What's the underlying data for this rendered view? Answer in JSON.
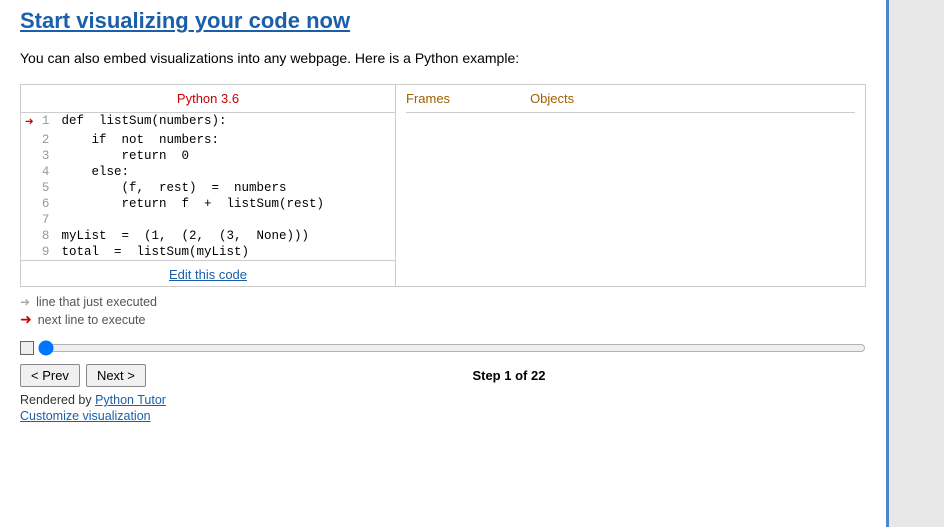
{
  "header": {
    "title": "Start visualizing your code now"
  },
  "embed_text": "You can also embed visualizations into any webpage. Here is a Python example:",
  "code_panel": {
    "header": "Python 3.6",
    "lines": [
      {
        "num": 1,
        "arrow": "red",
        "code": "def  listSum(numbers):"
      },
      {
        "num": 2,
        "arrow": "",
        "code": "    if  not  numbers:"
      },
      {
        "num": 3,
        "arrow": "",
        "code": "        return  0"
      },
      {
        "num": 4,
        "arrow": "",
        "code": "    else:"
      },
      {
        "num": 5,
        "arrow": "",
        "code": "        (f,  rest)  =  numbers"
      },
      {
        "num": 6,
        "arrow": "",
        "code": "        return  f  +  listSum(rest)"
      },
      {
        "num": 7,
        "arrow": "",
        "code": ""
      },
      {
        "num": 8,
        "arrow": "",
        "code": "myList  =  (1,  (2,  (3,  None)))"
      },
      {
        "num": 9,
        "arrow": "",
        "code": "total  =  listSum(myList)"
      }
    ],
    "edit_link": "Edit this code"
  },
  "frames_label": "Frames",
  "objects_label": "Objects",
  "legend": {
    "gray_text": "line that just executed",
    "red_text": "next line to execute"
  },
  "nav": {
    "prev_label": "< Prev",
    "next_label": "Next >",
    "step_text": "Step 1 of 22"
  },
  "footer": {
    "rendered_by": "Rendered by",
    "python_tutor_link": "Python Tutor",
    "customize_label": "Customize visualization"
  }
}
